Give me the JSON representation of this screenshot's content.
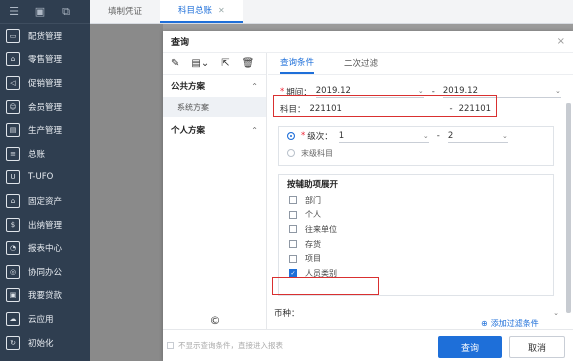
{
  "sidebar": {
    "top_icons": [
      "menu-icon",
      "layout-icon",
      "expand-icon"
    ],
    "items": [
      {
        "label": "配货管理",
        "icon": "box-icon"
      },
      {
        "label": "零售管理",
        "icon": "store-icon"
      },
      {
        "label": "促销管理",
        "icon": "megaphone-icon"
      },
      {
        "label": "会员管理",
        "icon": "member-icon"
      },
      {
        "label": "生产管理",
        "icon": "factory-icon"
      },
      {
        "label": "总账",
        "icon": "ledger-icon"
      },
      {
        "label": "T-UFO",
        "icon": "ufo-report-icon"
      },
      {
        "label": "固定资产",
        "icon": "bank-icon"
      },
      {
        "label": "出纳管理",
        "icon": "cashier-icon"
      },
      {
        "label": "报表中心",
        "icon": "report-icon"
      },
      {
        "label": "协同办公",
        "icon": "collab-icon"
      },
      {
        "label": "我要贷款",
        "icon": "loan-icon"
      },
      {
        "label": "云应用",
        "icon": "cloud-icon"
      },
      {
        "label": "初始化",
        "icon": "init-icon"
      }
    ]
  },
  "topbar": {
    "tabs": [
      {
        "label": "填制凭证",
        "active": false
      },
      {
        "label": "科目总账",
        "active": true
      }
    ]
  },
  "dialog": {
    "title": "查询",
    "close": "×",
    "left": {
      "toolbar_icons": [
        "edit-icon",
        "save-icon",
        "export-icon",
        "delete-icon"
      ],
      "public_scheme": "公共方案",
      "system_scheme": "系统方案",
      "personal_scheme": "个人方案",
      "bottom_icon": "©"
    },
    "tabs": [
      "查询条件",
      "二次过滤"
    ],
    "period": {
      "label": "期间：",
      "from": "2019.12",
      "to": "2019.12"
    },
    "subject": {
      "label": "科目：",
      "from": "221101",
      "to": "221101"
    },
    "level": {
      "label": "级次：",
      "from": "1",
      "to": "2"
    },
    "last_level": "末级科目",
    "aux_title": "按辅助项展开",
    "aux_items": [
      {
        "label": "部门",
        "checked": false
      },
      {
        "label": "个人",
        "checked": false
      },
      {
        "label": "往来单位",
        "checked": false
      },
      {
        "label": "存货",
        "checked": false
      },
      {
        "label": "项目",
        "checked": false
      },
      {
        "label": "人员类别",
        "checked": true
      }
    ],
    "currency_label": "币种：",
    "add_filter": "添加过滤条件",
    "footer_note": "不显示查询条件，直接进入报表",
    "query_button": "查询",
    "cancel_button": "取消"
  },
  "colors": {
    "accent": "#1e6fd9",
    "highlight": "#d93030",
    "sidebar": "#2f3e50"
  }
}
